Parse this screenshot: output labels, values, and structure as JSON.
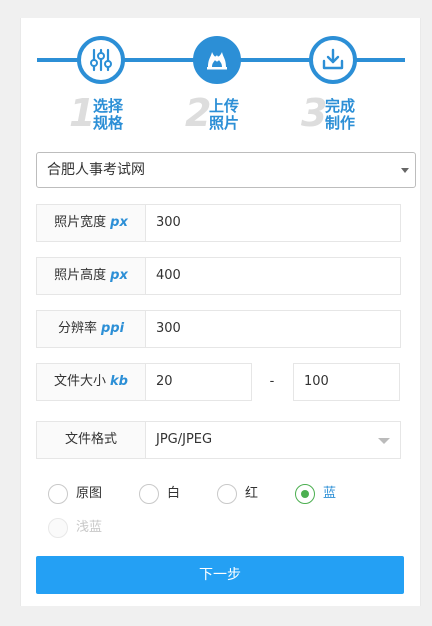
{
  "steps": [
    {
      "num": "1",
      "line1": "选择",
      "line2": "规格",
      "icon": "sliders-icon"
    },
    {
      "num": "2",
      "line1": "上传",
      "line2": "照片",
      "icon": "flame-icon"
    },
    {
      "num": "3",
      "line1": "完成",
      "line2": "制作",
      "icon": "download-icon"
    }
  ],
  "site_select": {
    "value": "合肥人事考试网"
  },
  "fields": {
    "width": {
      "label": "照片宽度",
      "unit": "px",
      "value": "300"
    },
    "height": {
      "label": "照片高度",
      "unit": "px",
      "value": "400"
    },
    "resolution": {
      "label": "分辨率",
      "unit": "ppi",
      "value": "300"
    },
    "filesize": {
      "label": "文件大小",
      "unit": "kb",
      "min": "20",
      "separator": "-",
      "max": "100"
    },
    "format": {
      "label": "文件格式",
      "value": "JPG/JPEG"
    }
  },
  "background_options": [
    {
      "label": "原图",
      "checked": false,
      "disabled": false
    },
    {
      "label": "白",
      "checked": false,
      "disabled": false
    },
    {
      "label": "红",
      "checked": false,
      "disabled": false
    },
    {
      "label": "蓝",
      "checked": true,
      "disabled": false
    },
    {
      "label": "浅蓝",
      "checked": false,
      "disabled": true
    }
  ],
  "next_button": {
    "label": "下一步"
  },
  "colors": {
    "accent": "#2c8fd6",
    "button": "#24a0f4",
    "radio_checked": "#4caf50"
  }
}
